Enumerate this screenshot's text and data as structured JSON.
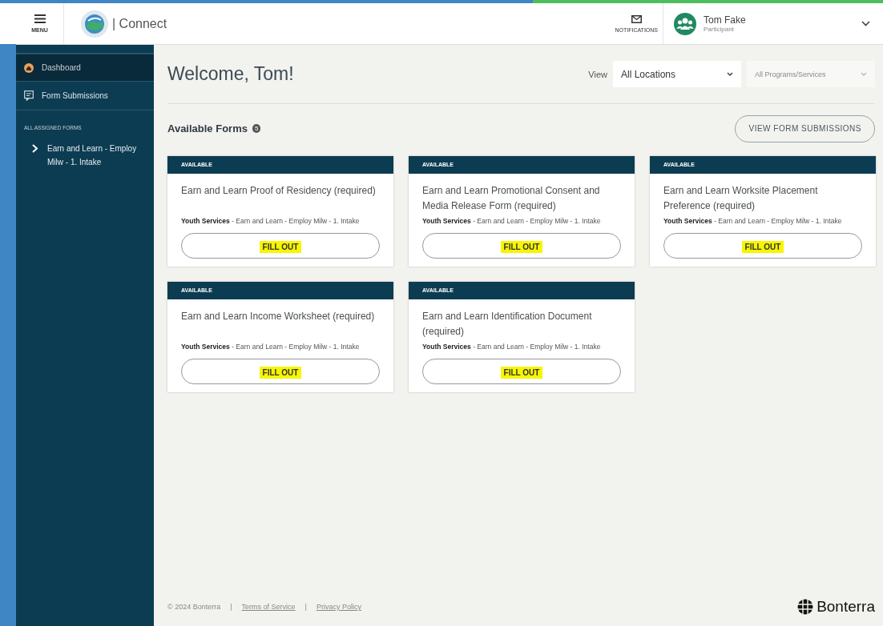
{
  "header": {
    "menu_label": "MENU",
    "app_name": "| Connect",
    "notifications_label": "NOTIFICATIONS",
    "user": {
      "name": "Tom Fake",
      "role": "Participant"
    }
  },
  "sidebar": {
    "items": [
      {
        "label": "Dashboard",
        "selected": true,
        "kind": "home"
      },
      {
        "label": "Form Submissions",
        "selected": false,
        "kind": "forms"
      }
    ],
    "section_title": "ALL ASSIGNED FORMS",
    "tree": [
      {
        "label": "Earn and Learn - Employ Milw - 1. Intake",
        "expanded": false
      }
    ]
  },
  "main": {
    "title": "Welcome, Tom!",
    "view_label": "View",
    "filters": [
      {
        "value": "All Locations",
        "disabled": false
      },
      {
        "placeholder": "All Programs/Services",
        "disabled": true
      }
    ],
    "section_title": "Available Forms",
    "count": "5",
    "view_button": "VIEW FORM SUBMISSIONS",
    "cards": [
      {
        "status": "AVAILABLE",
        "title": "Earn and Learn Proof of Residency (required)",
        "program": "Youth Services",
        "path": " - Earn and Learn - Employ Milw - 1. Intake",
        "action": "FILL OUT",
        "highlighted": true
      },
      {
        "status": "AVAILABLE",
        "title": "Earn and Learn Promotional Consent and Media Release Form (required)",
        "program": "Youth Services",
        "path": " - Earn and Learn - Employ Milw - 1. Intake",
        "action": "FILL OUT",
        "highlighted": true
      },
      {
        "status": "AVAILABLE",
        "title": "Earn and Learn Worksite Placement Preference (required)",
        "program": "Youth Services",
        "path": " - Earn and Learn - Employ Milw - 1. Intake",
        "action": "FILL OUT",
        "highlighted": true
      },
      {
        "status": "AVAILABLE",
        "title": "Earn and Learn Income Worksheet (required)",
        "program": "Youth Services",
        "path": " - Earn and Learn - Employ Milw - 1. Intake",
        "action": "FILL OUT",
        "highlighted": true
      },
      {
        "status": "AVAILABLE",
        "title": "Earn and Learn Identification Document (required)",
        "program": "Youth Services",
        "path": " - Earn and Learn - Employ Milw - 1. Intake",
        "action": "FILL OUT",
        "highlighted": true
      }
    ]
  },
  "footer": {
    "copyright": "© 2024 Bonterra",
    "separator_1": "|",
    "terms": "Terms of Service",
    "separator_2": "|",
    "privacy": "Privacy Policy",
    "brand": "Bonterra"
  }
}
